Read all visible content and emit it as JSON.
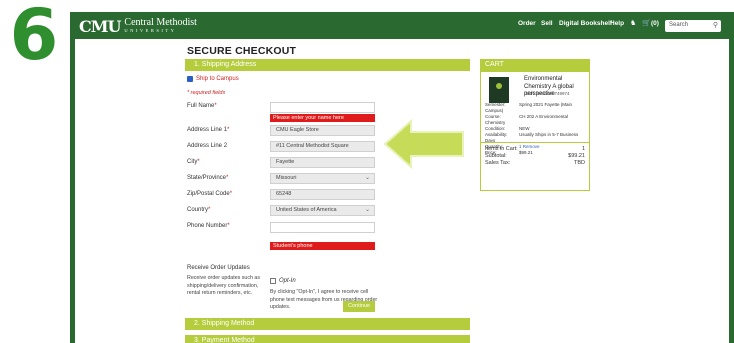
{
  "step_number": "6",
  "header": {
    "logo_mark": "CMU",
    "logo_line1": "Central Methodist",
    "logo_line2": "UNIVERSITY",
    "nav": [
      "Order",
      "Sell",
      "Digital Bookshelf",
      "Help"
    ],
    "cart_label": "(0)",
    "search_placeholder": "Search"
  },
  "page_title": "SECURE CHECKOUT",
  "sections": {
    "shipping_address": "1. Shipping Address",
    "shipping_method": "2. Shipping Method",
    "payment_method": "3. Payment Method"
  },
  "ship_to_campus": "Ship to Campus",
  "required_note": "* required fields",
  "form": {
    "full_name": {
      "label": "Full Name",
      "value": "",
      "error": "Please enter your name here"
    },
    "address1": {
      "label": "Address Line 1",
      "value": "CMU Eagle Store"
    },
    "address2": {
      "label": "Address Line 2",
      "value": "#11 Central Methodist Square"
    },
    "city": {
      "label": "City",
      "value": "Fayette"
    },
    "state": {
      "label": "State/Province",
      "value": "Missouri"
    },
    "zip": {
      "label": "Zip/Postal Code",
      "value": "65248"
    },
    "country": {
      "label": "Country",
      "value": "United States of America"
    },
    "phone": {
      "label": "Phone Number",
      "value": "",
      "error": "Student's phone"
    }
  },
  "updates": {
    "label": "Receive Order Updates",
    "description": "Receive order updates such as shipping/delivery confirmation, rental return reminders, etc.",
    "opt_in": "Opt-In",
    "consent": "By clicking \"Opt-In\", I agree to receive cell phone text messages from us regarding order updates."
  },
  "continue_label": "Continue",
  "cart": {
    "title": "CART",
    "book_title": "Environmental Chemistry A global perspective",
    "isbn": "ISBN: 9780198749974",
    "meta": [
      {
        "k": "Semester:",
        "v": "Spring 2021 Fayette (Main Campus)"
      },
      {
        "k": "Course:",
        "v": "CH 202 A Environmental Chemistry"
      },
      {
        "k": "Condition:",
        "v": "NEW"
      },
      {
        "k": "Availability:",
        "v": "Usually Ships in 5-7 Business Days"
      },
      {
        "k": "Quantity:",
        "v": "1 Remove"
      },
      {
        "k": "Price:",
        "v": "$99.21"
      }
    ],
    "items_label": "Items in Cart:",
    "items_value": "1",
    "subtotal_label": "Subtotal:",
    "subtotal_value": "$99.21",
    "tax_label": "Sales Tax:",
    "tax_value": "TBD"
  },
  "colors": {
    "brand_green": "#2a6a31",
    "accent_lime": "#b5cd3d",
    "error_red": "#e01b1b"
  }
}
